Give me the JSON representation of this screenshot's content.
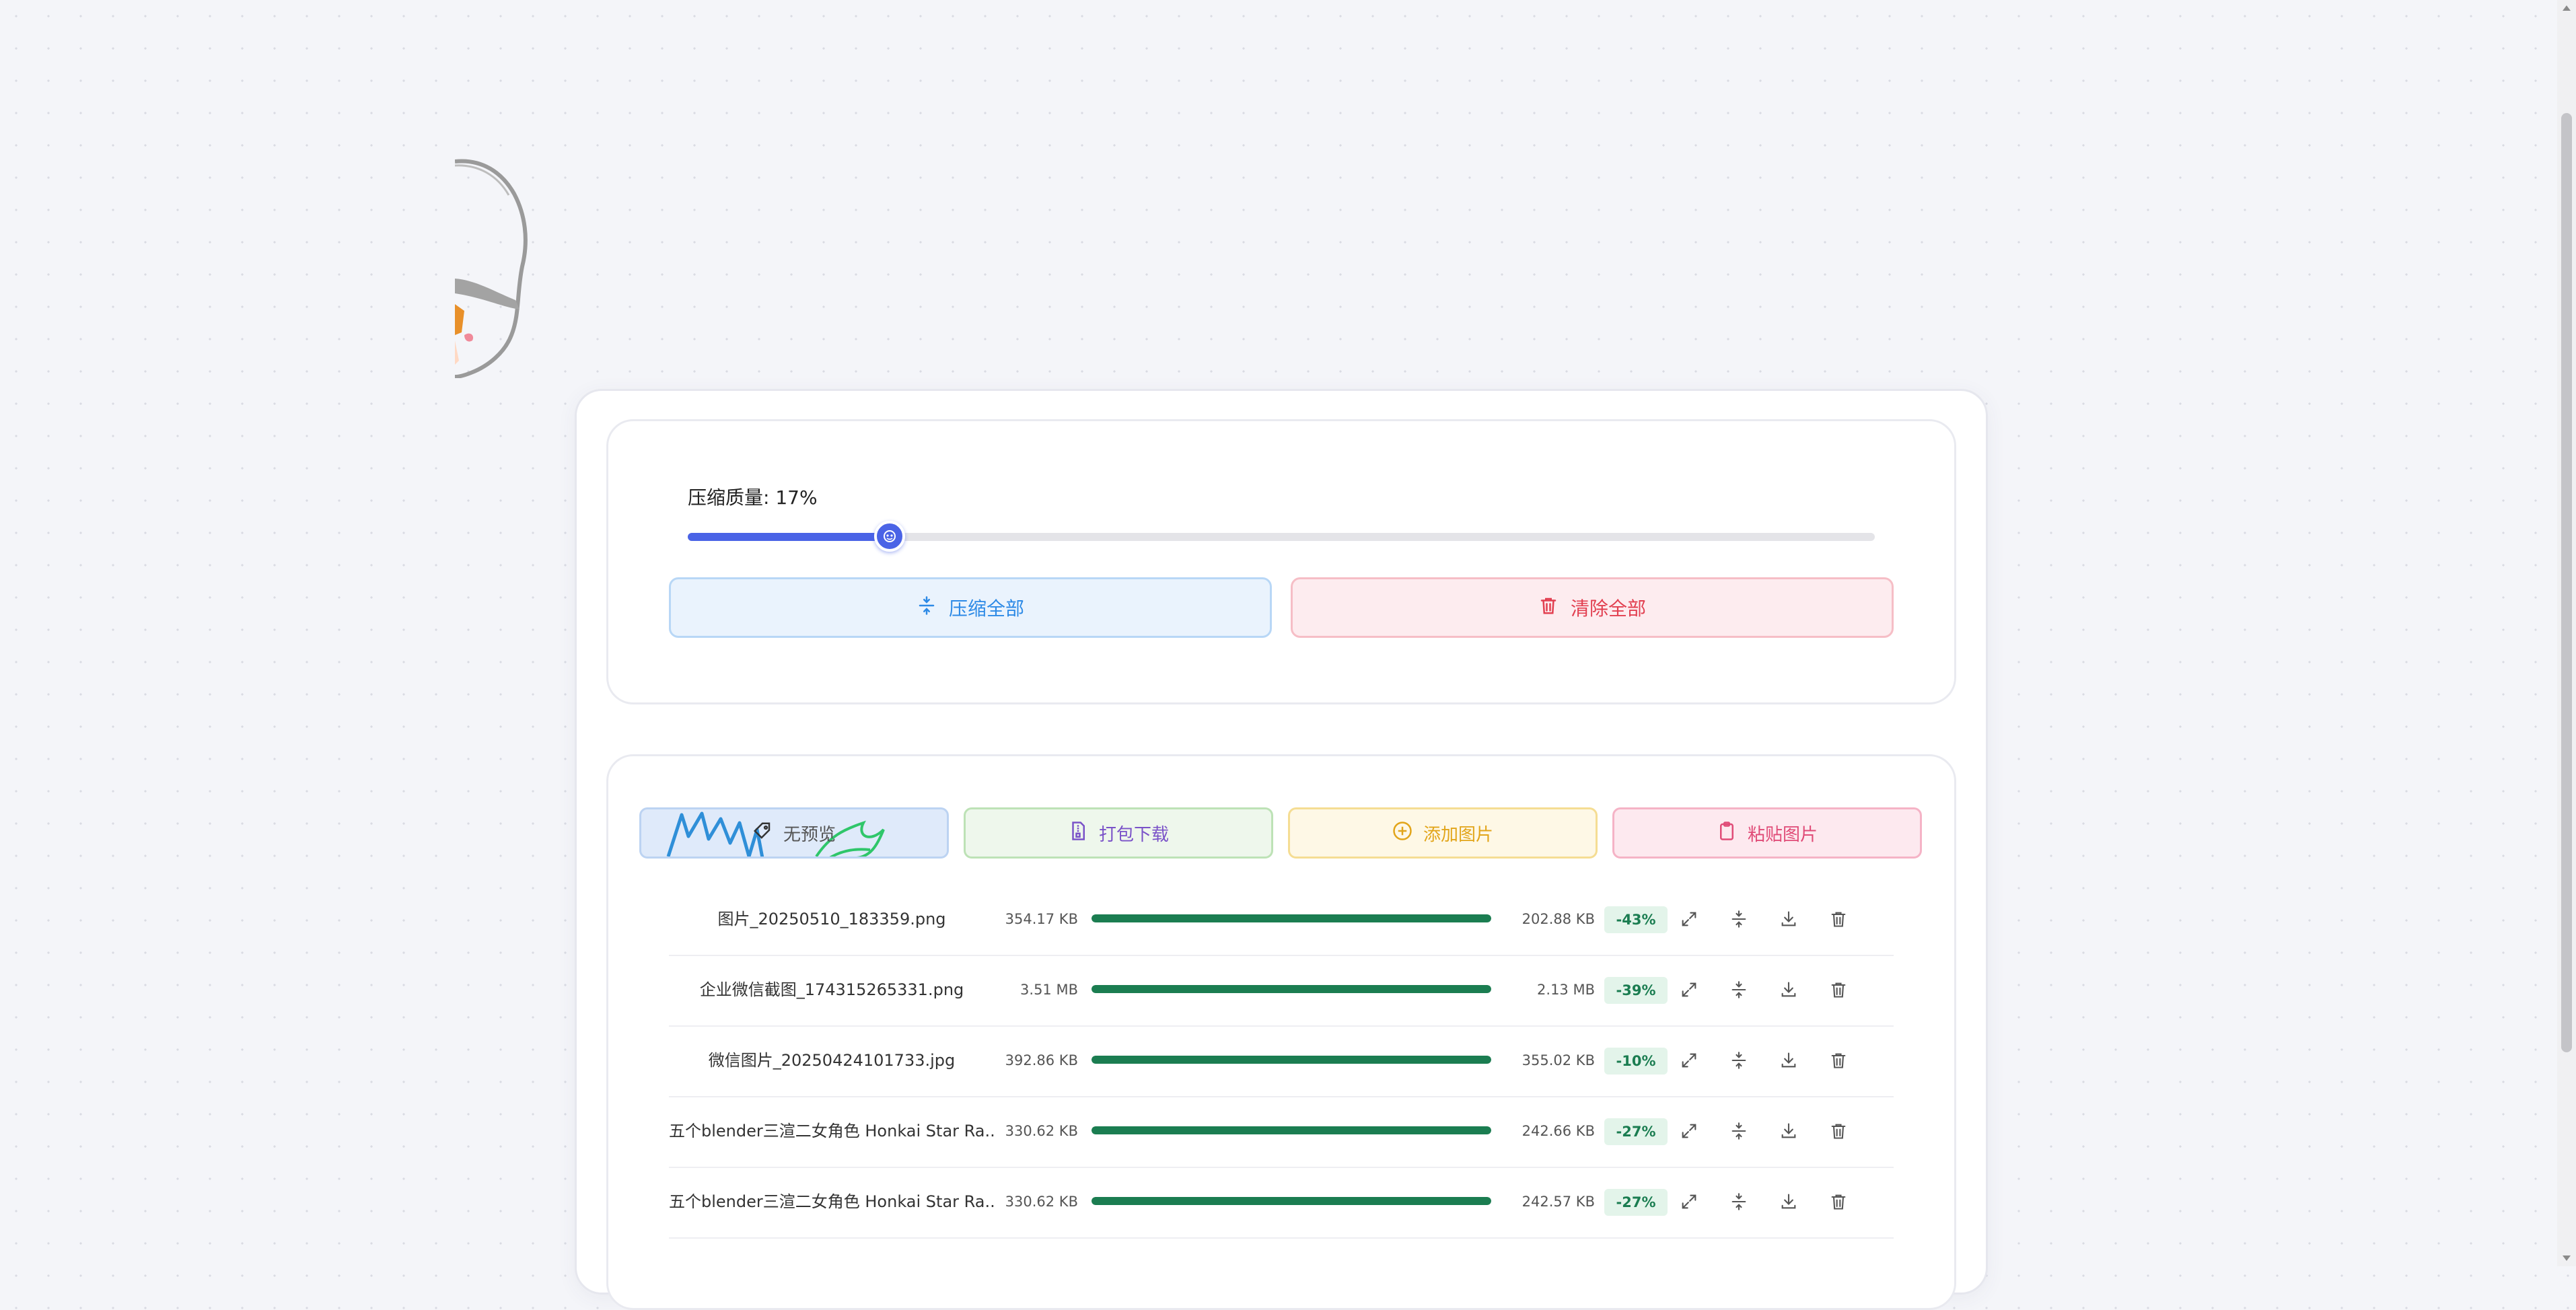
{
  "settings": {
    "quality_label": "压缩质量: 17%",
    "quality_value": 17,
    "compress_all_label": "压缩全部",
    "clear_all_label": "清除全部"
  },
  "actions": {
    "no_preview_label": "无预览",
    "download_zip_label": "打包下载",
    "add_image_label": "添加图片",
    "paste_image_label": "粘贴图片"
  },
  "files": [
    {
      "name": "图片_20250510_183359.png",
      "original_size": "354.17 KB",
      "progress": 100,
      "compressed_size": "202.88 KB",
      "reduction": "-43%"
    },
    {
      "name": "企业微信截图_174315265331.png",
      "original_size": "3.51 MB",
      "progress": 100,
      "compressed_size": "2.13 MB",
      "reduction": "-39%"
    },
    {
      "name": "微信图片_20250424101733.jpg",
      "original_size": "392.86 KB",
      "progress": 100,
      "compressed_size": "355.02 KB",
      "reduction": "-10%"
    },
    {
      "name": "五个blender三渲二女角色 Honkai Star Ra...",
      "original_size": "330.62 KB",
      "progress": 100,
      "compressed_size": "242.66 KB",
      "reduction": "-27%"
    },
    {
      "name": "五个blender三渲二女角色 Honkai Star Ra...",
      "original_size": "330.62 KB",
      "progress": 100,
      "compressed_size": "242.57 KB",
      "reduction": "-27%"
    }
  ],
  "colors": {
    "accent": "#4a63e6",
    "progress": "#1b7d51",
    "danger": "#e23f50"
  },
  "icons": {
    "row": [
      "expand-icon",
      "compress-icon",
      "download-icon",
      "trash-icon"
    ]
  }
}
